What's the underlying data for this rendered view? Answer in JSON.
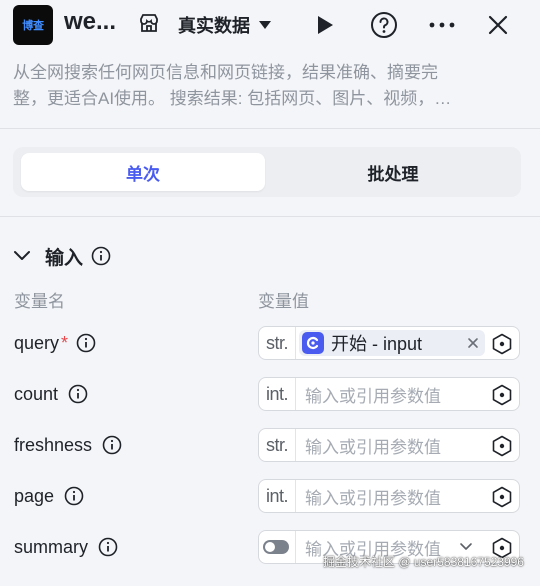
{
  "header": {
    "logo_text": "博查",
    "title": "we...",
    "environment_label": "真实数据",
    "description_line1": "从全网搜索任何网页信息和网页链接，结果准确、摘要完",
    "description_line2": "整，更适合AI使用。 搜索结果: 包括网页、图片、视频，…"
  },
  "mode_tabs": {
    "single": "单次",
    "batch": "批处理",
    "selected": "单次"
  },
  "input_section": {
    "title": "输入",
    "col_name": "变量名",
    "col_value": "变量值",
    "rows": [
      {
        "name": "query",
        "required": "*",
        "type": "str.",
        "chip_text": "开始 - input"
      },
      {
        "name": "count",
        "type": "int.",
        "placeholder": "输入或引用参数值"
      },
      {
        "name": "freshness",
        "type": "str.",
        "placeholder": "输入或引用参数值"
      },
      {
        "name": "page",
        "type": "int.",
        "placeholder": "输入或引用参数值"
      },
      {
        "name": "summary",
        "type": "bool",
        "toggle": "off",
        "placeholder": "输入或引用参数值"
      }
    ]
  },
  "watermark": "掘金技术社区 @ user5838167523996",
  "colors": {
    "accent": "#4a5cf0",
    "required": "#e5484d",
    "muted_text": "#8f959e"
  }
}
